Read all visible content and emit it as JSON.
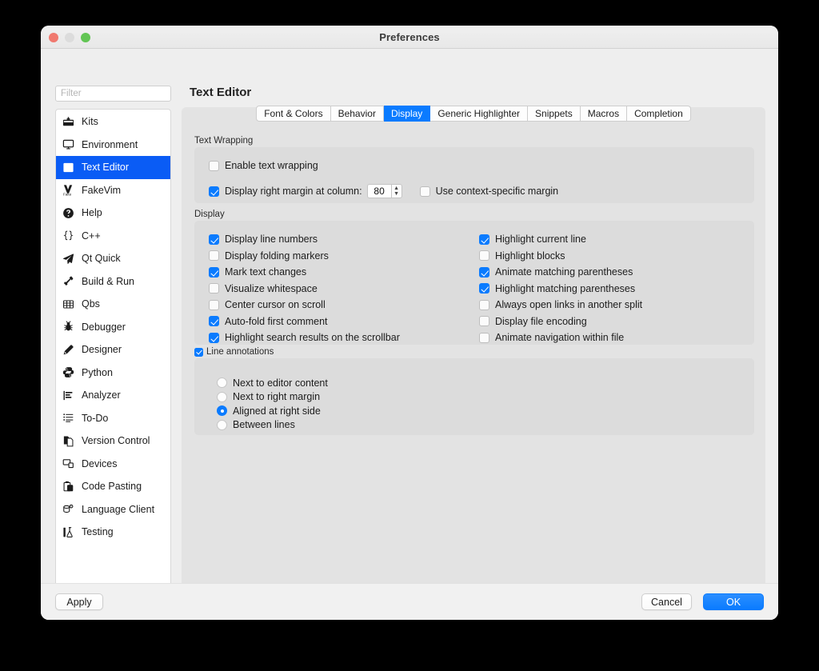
{
  "window": {
    "title": "Preferences",
    "traffic_lights": [
      "close-button",
      "minimize-button",
      "zoom-button"
    ]
  },
  "search": {
    "placeholder": "Filter",
    "value": ""
  },
  "sidebar": {
    "items": [
      {
        "label": "Kits",
        "icon": "kits-icon",
        "selected": false
      },
      {
        "label": "Environment",
        "icon": "monitor-icon",
        "selected": false
      },
      {
        "label": "Text Editor",
        "icon": "text-editor-icon",
        "selected": true
      },
      {
        "label": "FakeVim",
        "icon": "fakevim-icon",
        "selected": false
      },
      {
        "label": "Help",
        "icon": "help-icon",
        "selected": false
      },
      {
        "label": "C++",
        "icon": "braces-icon",
        "selected": false
      },
      {
        "label": "Qt Quick",
        "icon": "paper-plane-icon",
        "selected": false
      },
      {
        "label": "Build & Run",
        "icon": "hammer-icon",
        "selected": false
      },
      {
        "label": "Qbs",
        "icon": "grid-icon",
        "selected": false
      },
      {
        "label": "Debugger",
        "icon": "bug-icon",
        "selected": false
      },
      {
        "label": "Designer",
        "icon": "pencil-icon",
        "selected": false
      },
      {
        "label": "Python",
        "icon": "python-icon",
        "selected": false
      },
      {
        "label": "Analyzer",
        "icon": "analyzer-icon",
        "selected": false
      },
      {
        "label": "To-Do",
        "icon": "list-icon",
        "selected": false
      },
      {
        "label": "Version Control",
        "icon": "version-control-icon",
        "selected": false
      },
      {
        "label": "Devices",
        "icon": "devices-icon",
        "selected": false
      },
      {
        "label": "Code Pasting",
        "icon": "clipboard-icon",
        "selected": false
      },
      {
        "label": "Language Client",
        "icon": "language-client-icon",
        "selected": false
      },
      {
        "label": "Testing",
        "icon": "flask-icon",
        "selected": false
      }
    ]
  },
  "page": {
    "title": "Text Editor"
  },
  "tabs": [
    {
      "label": "Font & Colors",
      "active": false
    },
    {
      "label": "Behavior",
      "active": false
    },
    {
      "label": "Display",
      "active": true
    },
    {
      "label": "Generic Highlighter",
      "active": false
    },
    {
      "label": "Snippets",
      "active": false
    },
    {
      "label": "Macros",
      "active": false
    },
    {
      "label": "Completion",
      "active": false
    }
  ],
  "text_wrapping": {
    "group_label": "Text Wrapping",
    "enable_wrapping": {
      "label": "Enable text wrapping",
      "checked": false
    },
    "right_margin": {
      "label": "Display right margin at column:",
      "checked": true
    },
    "column_value": "80",
    "context_margin": {
      "label": "Use context-specific margin",
      "checked": false
    }
  },
  "display": {
    "group_label": "Display",
    "left_column": [
      {
        "label": "Display line numbers",
        "checked": true
      },
      {
        "label": "Display folding markers",
        "checked": false
      },
      {
        "label": "Mark text changes",
        "checked": true
      },
      {
        "label": "Visualize whitespace",
        "checked": false
      },
      {
        "label": "Center cursor on scroll",
        "checked": false
      },
      {
        "label": "Auto-fold first comment",
        "checked": true
      },
      {
        "label": "Highlight search results on the scrollbar",
        "checked": true
      }
    ],
    "right_column": [
      {
        "label": "Highlight current line",
        "checked": true
      },
      {
        "label": "Highlight blocks",
        "checked": false
      },
      {
        "label": "Animate matching parentheses",
        "checked": true
      },
      {
        "label": "Highlight matching parentheses",
        "checked": true
      },
      {
        "label": "Always open links in another split",
        "checked": false
      },
      {
        "label": "Display file encoding",
        "checked": false
      },
      {
        "label": "Animate navigation within file",
        "checked": false
      }
    ]
  },
  "line_annotations": {
    "group_label": "Line annotations",
    "group_checked": true,
    "options": [
      {
        "label": "Next to editor content",
        "selected": false
      },
      {
        "label": "Next to right margin",
        "selected": false
      },
      {
        "label": "Aligned at right side",
        "selected": true
      },
      {
        "label": "Between lines",
        "selected": false
      }
    ]
  },
  "footer": {
    "apply": "Apply",
    "cancel": "Cancel",
    "ok": "OK"
  },
  "colors": {
    "accent": "#0a7bff",
    "selection": "#0a5cf5",
    "window_bg": "#eeeeee",
    "pane_bg": "#e3e3e3",
    "group_bg": "#dcdcdc"
  }
}
